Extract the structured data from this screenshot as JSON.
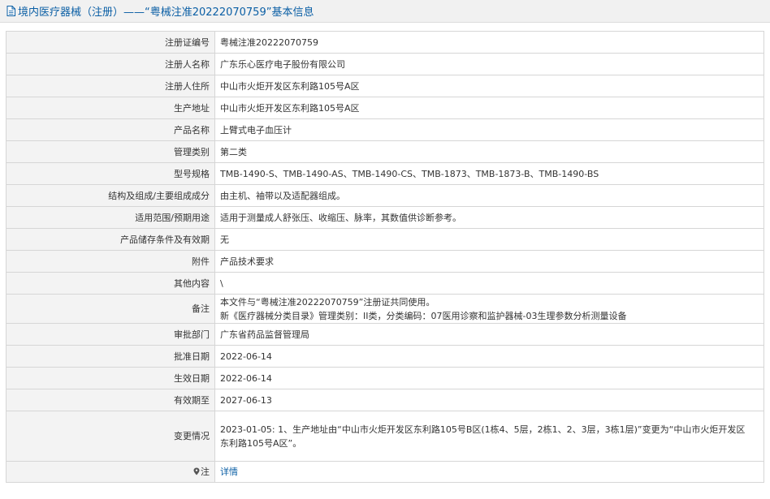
{
  "header": {
    "icon": "document-icon",
    "title": "境内医疗器械（注册）——“粤械注准20222070759”基本信息"
  },
  "rows": [
    {
      "label": "注册证编号",
      "value": "粤械注准20222070759"
    },
    {
      "label": "注册人名称",
      "value": "广东乐心医疗电子股份有限公司"
    },
    {
      "label": "注册人住所",
      "value": "中山市火炬开发区东利路105号A区"
    },
    {
      "label": "生产地址",
      "value": "中山市火炬开发区东利路105号A区"
    },
    {
      "label": "产品名称",
      "value": "上臂式电子血压计"
    },
    {
      "label": "管理类别",
      "value": "第二类"
    },
    {
      "label": "型号规格",
      "value": "TMB-1490-S、TMB-1490-AS、TMB-1490-CS、TMB-1873、TMB-1873-B、TMB-1490-BS"
    },
    {
      "label": "结构及组成/主要组成成分",
      "value": "由主机、袖带以及适配器组成。"
    },
    {
      "label": "适用范围/预期用途",
      "value": "适用于测量成人舒张压、收缩压、脉率，其数值供诊断参考。"
    },
    {
      "label": "产品储存条件及有效期",
      "value": "无"
    },
    {
      "label": "附件",
      "value": "产品技术要求"
    },
    {
      "label": "其他内容",
      "value": "\\"
    },
    {
      "label": "备注",
      "lines": [
        "本文件与“粤械注准20222070759”注册证共同使用。",
        "新《医疗器械分类目录》管理类别：II类，分类编码：07医用诊察和监护器械-03生理参数分析测量设备"
      ]
    },
    {
      "label": "审批部门",
      "value": "广东省药品监督管理局"
    },
    {
      "label": "批准日期",
      "value": "2022-06-14"
    },
    {
      "label": "生效日期",
      "value": "2022-06-14"
    },
    {
      "label": "有效期至",
      "value": "2027-06-13"
    },
    {
      "label": "变更情况",
      "lines": [
        "2023-01-05: 1、生产地址由“中山市火炬开发区东利路105号B区(1栋4、5层，2栋1、2、3层，3栋1层)”变更为“中山市火炬开发区",
        "东利路105号A区”。"
      ]
    },
    {
      "label": "注",
      "icon": "location-pin-icon",
      "link": "详情"
    }
  ]
}
